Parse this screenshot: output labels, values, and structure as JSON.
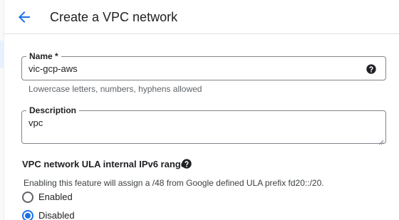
{
  "header": {
    "title": "Create a VPC network",
    "back_icon": "arrow-back-icon"
  },
  "colors": {
    "accent": "#1a73e8",
    "border": "#80868b",
    "hint_text": "#5f6368"
  },
  "form": {
    "name": {
      "label": "Name *",
      "value": "vic-gcp-aws",
      "hint": "Lowercase letters, numbers, hyphens allowed",
      "help_icon": "help-circle-icon"
    },
    "description": {
      "label": "Description",
      "value": "vpc"
    },
    "ula": {
      "title": "VPC network ULA internal IPv6 range",
      "help_icon": "help-circle-icon",
      "description": "Enabling this feature will assign a /48 from Google defined ULA prefix fd20::/20.",
      "options": [
        {
          "label": "Enabled",
          "checked": false
        },
        {
          "label": "Disabled",
          "checked": true
        }
      ]
    }
  }
}
